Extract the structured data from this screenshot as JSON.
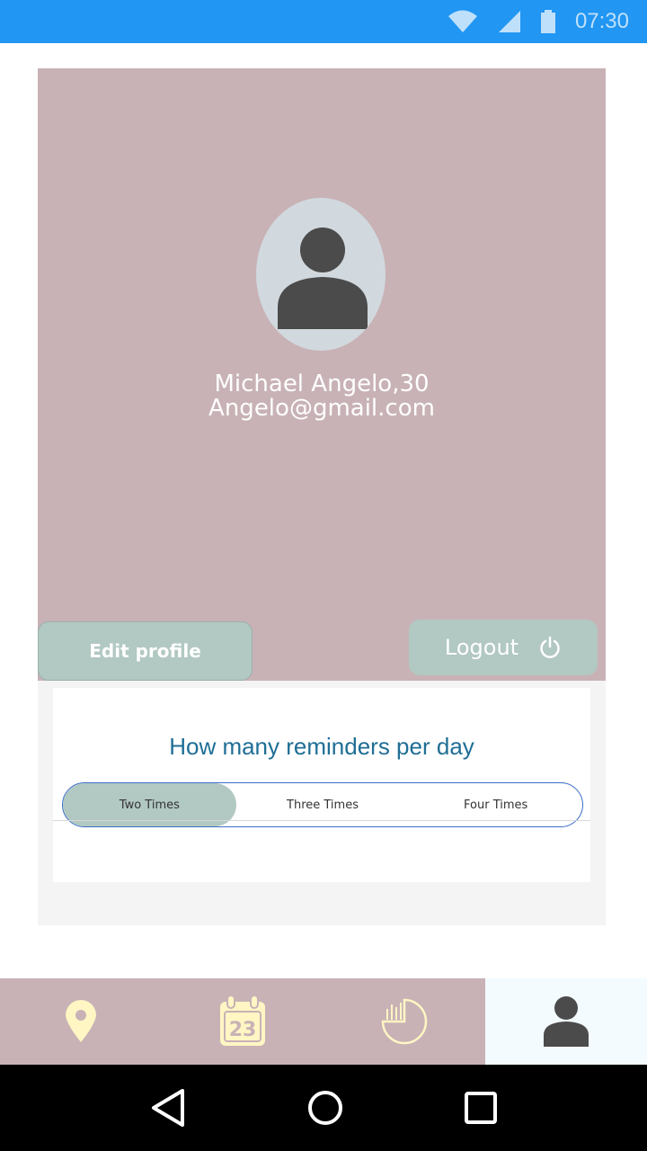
{
  "status_bar": {
    "time": "07:30",
    "icons": [
      "wifi-icon",
      "signal-icon",
      "battery-icon"
    ]
  },
  "profile": {
    "name_age": "Michael Angelo,30",
    "email": "Angelo@gmail.com",
    "edit_label": "Edit profile",
    "logout_label": "Logout"
  },
  "reminders": {
    "question": "How many reminders per day",
    "options": [
      "Two Times",
      "Three Times",
      "Four Times"
    ],
    "selected": "Two Times"
  },
  "bottom_nav": {
    "items": [
      {
        "icon": "location-pin-icon",
        "active": false
      },
      {
        "icon": "calendar-icon",
        "label": "23",
        "active": false
      },
      {
        "icon": "chart-icon",
        "active": false
      },
      {
        "icon": "profile-icon",
        "active": true
      }
    ]
  },
  "colors": {
    "status_bar": "#2196f3",
    "card": "#c8b2b6",
    "button": "#b2c8c2",
    "question": "#1f6e95",
    "icon_yellow": "#fff6c4"
  }
}
